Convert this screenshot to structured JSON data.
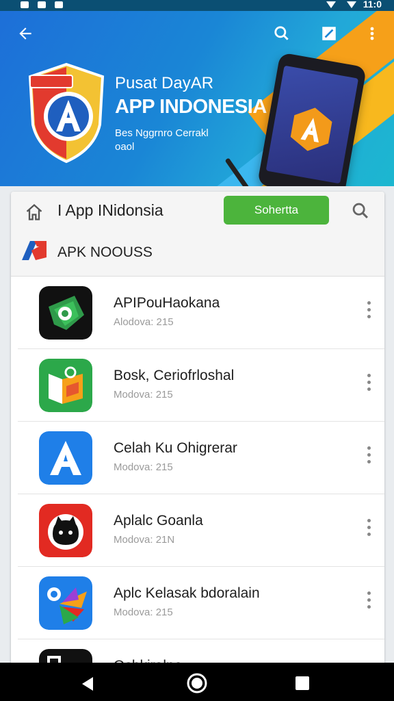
{
  "status_bar": {
    "time": "11:0"
  },
  "banner": {
    "subtitle": "Pusat DayAR",
    "title": "APP INDONESIA",
    "tagline_line1": "Bes Nggrnro Cerrakl",
    "tagline_line2": "oaol",
    "accent": "#f6a019"
  },
  "header": {
    "title": "I App INidonsia",
    "search_button": "Sohertta",
    "section_label": "APK NOOUSS"
  },
  "apps": [
    {
      "name": "APIPouHaokana",
      "meta": "Alodova: 215",
      "icon": "map-pin-icon"
    },
    {
      "name": "Bosk, Ceriofrloshal",
      "meta": "Modova: 215",
      "icon": "book-icon"
    },
    {
      "name": "Celah Ku Ohigrerar",
      "meta": "Modova: 215",
      "icon": "letter-a-icon"
    },
    {
      "name": "Aplalc Goanla",
      "meta": "Modova: 21N",
      "icon": "cat-icon"
    },
    {
      "name": "Aplc Kelasak bdoralain",
      "meta": "Modova: 215",
      "icon": "colorful-bird-icon"
    },
    {
      "name": "Osbkiralne",
      "meta": "",
      "icon": "app-icon"
    }
  ]
}
